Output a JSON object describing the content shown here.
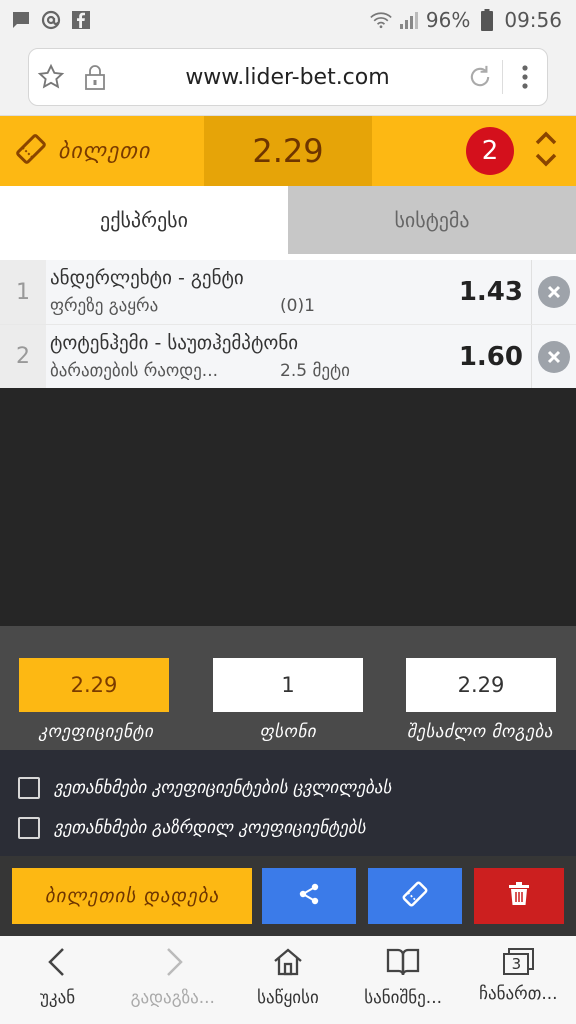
{
  "status_bar": {
    "battery": "96%",
    "time": "09:56"
  },
  "browser": {
    "url": "www.lider-bet.com"
  },
  "ticket": {
    "label": "ბილეთი",
    "total_odds": "2.29",
    "count": "2"
  },
  "tabs": [
    {
      "label": "ექსპრესი",
      "active": true
    },
    {
      "label": "სისტემა",
      "active": false
    }
  ],
  "bets": [
    {
      "num": "1",
      "match": "ანდერლეხტი - გენტი",
      "market": "ფრეზე გაყრა",
      "pick": "(0)1",
      "odds": "1.43"
    },
    {
      "num": "2",
      "match": "ტოტენჰემი - საუთჰემპტონი",
      "market": "ბარათების რაოდე...",
      "pick": "2.5 მეტი",
      "odds": "1.60"
    }
  ],
  "stake": {
    "coefficient_value": "2.29",
    "coefficient_label": "კოეფიციენტი",
    "amount_value": "1",
    "amount_label": "ფსონი",
    "win_value": "2.29",
    "win_label": "შესაძლო მოგება"
  },
  "checkboxes": [
    {
      "label": "ვეთანხმები კოეფიციენტების ცვლილებას",
      "checked": false
    },
    {
      "label": "ვეთანხმები გაზრდილ კოეფიციენტებს",
      "checked": false
    }
  ],
  "actions": {
    "place_label": "ბილეთის დადება"
  },
  "bottom_nav": [
    {
      "label": "უკან",
      "icon": "back-icon"
    },
    {
      "label": "გადაგზა...",
      "icon": "forward-icon"
    },
    {
      "label": "საწყისი",
      "icon": "home-icon"
    },
    {
      "label": "სანიშნე...",
      "icon": "bookmarks-icon"
    },
    {
      "label": "ჩანართ...",
      "icon": "tabs-icon",
      "badge": "3"
    }
  ],
  "colors": {
    "accent": "#fdb813",
    "accent_dark": "#e6a408",
    "badge_red": "#d4101c",
    "share_blue": "#3b7be9",
    "delete_red": "#cc1f1f"
  }
}
